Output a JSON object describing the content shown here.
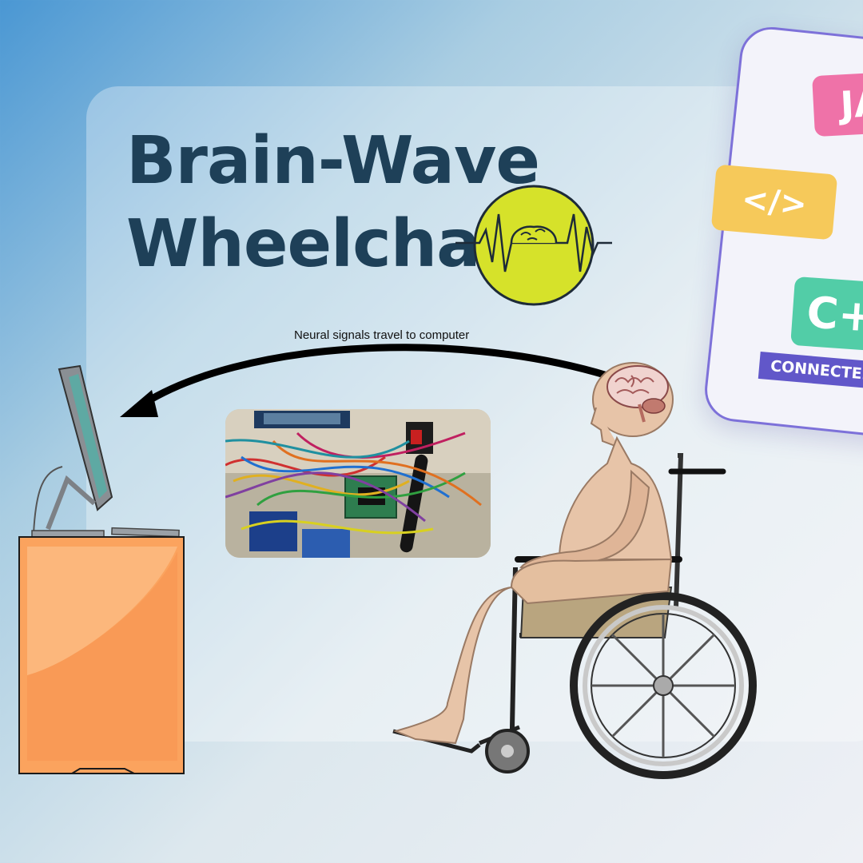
{
  "title": {
    "line1": "Brain-Wave",
    "line2": "Wheelchair"
  },
  "caption": "Neural signals travel to computer",
  "language_card": {
    "tags": [
      "JA",
      "</>",
      "C+"
    ],
    "status": "CONNECTED"
  },
  "colors": {
    "title": "#1e4058",
    "logo_circle": "#d6e22a",
    "desk": "#fba35e",
    "tag_ja": "#ef72a8",
    "tag_code": "#f6c95a",
    "tag_cpp": "#52cda7",
    "status_badge": "#6157c9"
  },
  "icons": [
    "brain-wave-logo-icon",
    "monitor-icon",
    "arrow-icon",
    "brain-icon",
    "wheelchair-icon"
  ]
}
